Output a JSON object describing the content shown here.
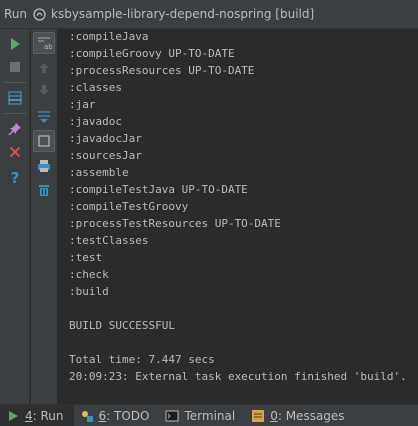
{
  "title_bar": {
    "run_label": "Run",
    "config_name": "ksbysample-library-depend-nospring [build]"
  },
  "toolbar_outer": [
    {
      "name": "rerun-icon",
      "color": "#59a869"
    },
    {
      "name": "stop-icon",
      "color": "#6e6e6e"
    },
    {
      "name": "layout-icon",
      "color": "#3592c4"
    },
    {
      "name": "pin-icon",
      "color": "#c285d5"
    },
    {
      "name": "close-icon",
      "color": "#c75450"
    },
    {
      "name": "help-icon",
      "color": "#3592c4"
    }
  ],
  "toolbar_inner": [
    {
      "name": "soft-wrap-icon"
    },
    {
      "name": "up-arrow-icon"
    },
    {
      "name": "down-arrow-icon"
    },
    {
      "name": "scroll-to-end-icon"
    },
    {
      "name": "print-icon"
    },
    {
      "name": "clear-all-icon"
    }
  ],
  "console": {
    "lines": [
      ":compileJava",
      ":compileGroovy UP-TO-DATE",
      ":processResources UP-TO-DATE",
      ":classes",
      ":jar",
      ":javadoc",
      ":javadocJar",
      ":sourcesJar",
      ":assemble",
      ":compileTestJava UP-TO-DATE",
      ":compileTestGroovy",
      ":processTestResources UP-TO-DATE",
      ":testClasses",
      ":test",
      ":check",
      ":build",
      "",
      "BUILD SUCCESSFUL",
      "",
      "Total time: 7.447 secs",
      "20:09:23: External task execution finished 'build'."
    ]
  },
  "bottom_tabs": [
    {
      "mnemonic": "4",
      "label": ": Run",
      "icon": "run-icon",
      "active": true
    },
    {
      "mnemonic": "6",
      "label": ": TODO",
      "icon": "todo-icon",
      "active": false
    },
    {
      "mnemonic": "",
      "label": "Terminal",
      "icon": "terminal-icon",
      "active": false
    },
    {
      "mnemonic": "0",
      "label": ": Messages",
      "icon": "messages-icon",
      "active": false
    }
  ]
}
